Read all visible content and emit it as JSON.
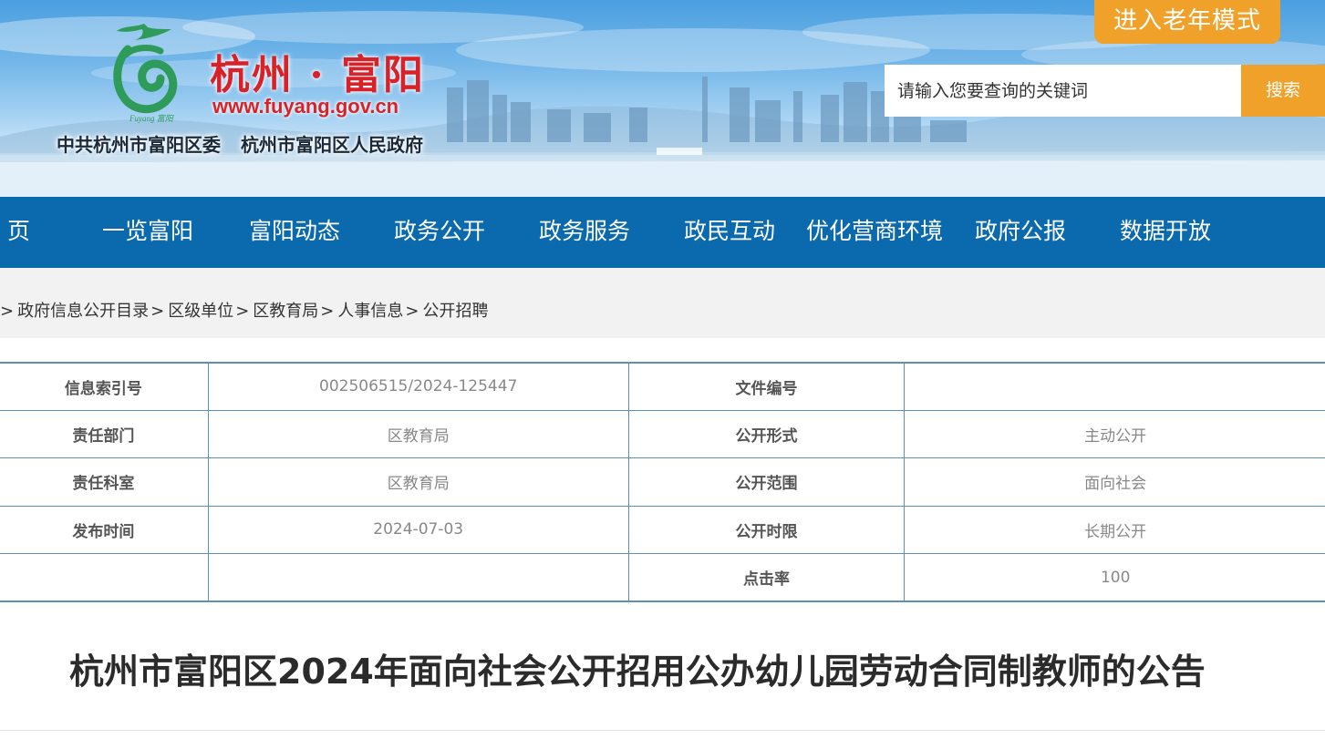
{
  "header": {
    "site_title": "杭州 · 富阳",
    "site_url": "www.fuyang.gov.cn",
    "org_party": "中共杭州市富阳区委",
    "org_government": "杭州市富阳区人民政府",
    "logo_caption": "Fuyang 富阳",
    "elder_mode_label": "进入老年模式",
    "search_placeholder": "请输入您要查询的关键词",
    "search_button_label": "搜索",
    "colors": {
      "accent_orange": "#f0a12a",
      "title_red": "#d8222a",
      "nav_blue": "#0b69ad"
    }
  },
  "nav": {
    "items": [
      {
        "label": "页"
      },
      {
        "label": "一览富阳"
      },
      {
        "label": "富阳动态"
      },
      {
        "label": "政务公开"
      },
      {
        "label": "政务服务"
      },
      {
        "label": "政民互动"
      },
      {
        "label": "优化营商环境"
      },
      {
        "label": "政府公报"
      },
      {
        "label": "数据开放"
      }
    ]
  },
  "breadcrumb": {
    "separator": ">",
    "items": [
      "政府信息公开目录",
      "区级单位",
      "区教育局",
      "人事信息",
      "公开招聘"
    ]
  },
  "info_table": {
    "rows": [
      {
        "label1": "信息索引号",
        "value1": "002506515/2024-125447",
        "label2": "文件编号",
        "value2": ""
      },
      {
        "label1": "责任部门",
        "value1": "区教育局",
        "label2": "公开形式",
        "value2": "主动公开"
      },
      {
        "label1": "责任科室",
        "value1": "区教育局",
        "label2": "公开范围",
        "value2": "面向社会"
      },
      {
        "label1": "发布时间",
        "value1": "2024-07-03",
        "label2": "公开时限",
        "value2": "长期公开"
      },
      {
        "label1": "",
        "value1": "",
        "label2": "点击率",
        "value2": "100"
      }
    ]
  },
  "article": {
    "title": "杭州市富阳区2024年面向社会公开招用公办幼儿园劳动合同制教师的公告"
  }
}
